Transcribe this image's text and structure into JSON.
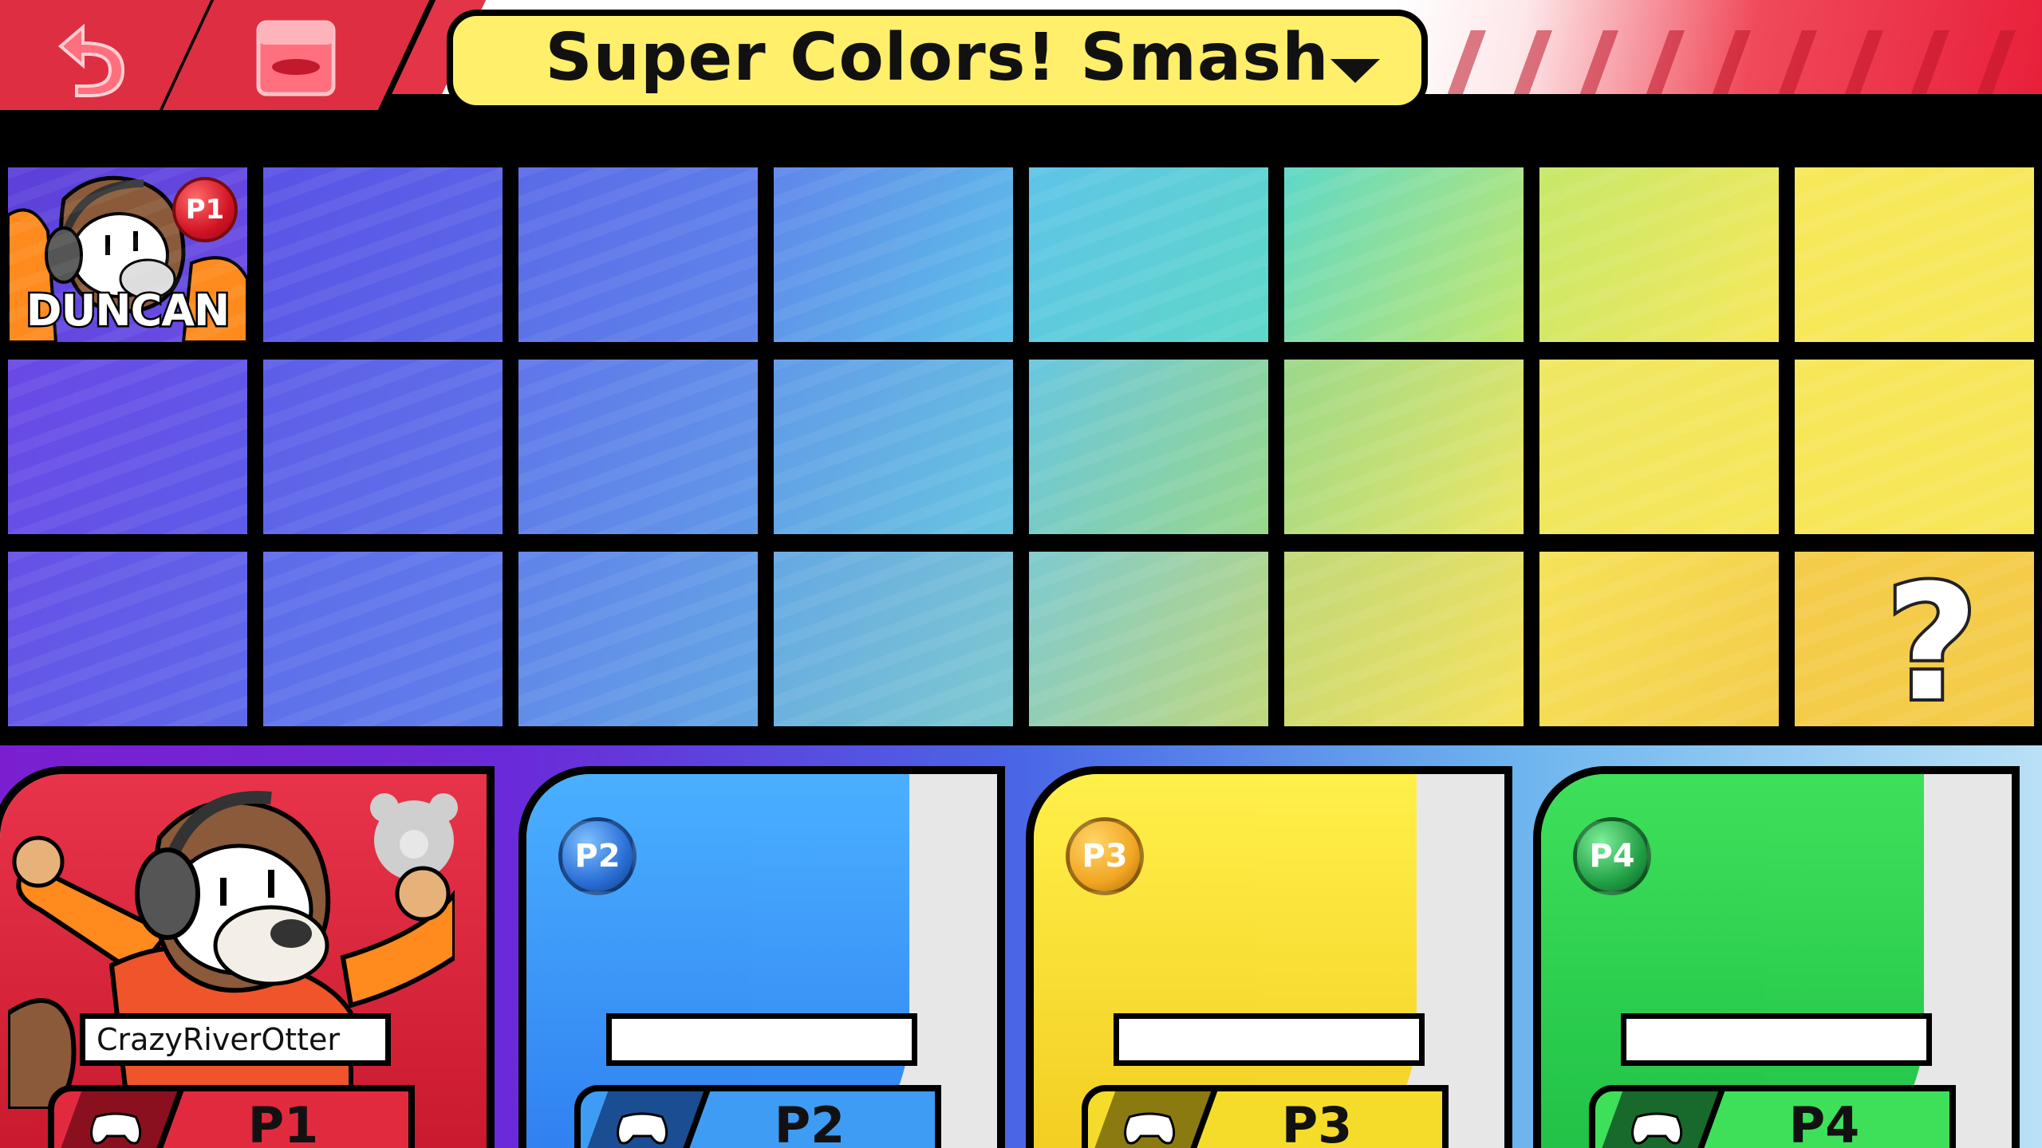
{
  "header": {
    "title": "Super Colors! Smash",
    "back_icon": "undo-arrow-icon",
    "rules_icon": "ruleset-icon",
    "dropdown_icon": "caret-down-icon"
  },
  "roster": {
    "fighters": [
      {
        "name": "DUNCAN",
        "token": "P1",
        "color": "#5b3fd8"
      }
    ],
    "random_label": "?",
    "row_colors": [
      [
        "#6a3ee0",
        "#5a52e6",
        "#5a6ae8",
        "#5f86ea",
        "#5ec4e8",
        "#5ed8c8",
        "#c6e86a",
        "#f7e85a"
      ],
      [
        "#6a48e6",
        "#5d5de8",
        "#5f75ea",
        "#609ae8",
        "#68c6e0",
        "#9ad88a",
        "#eee762",
        "#f7e658"
      ],
      [
        "#6650e6",
        "#5e6aea",
        "#5f82ea",
        "#64a8e4",
        "#7ecad0",
        "#c0d87a",
        "#f6e25a",
        "#f4cc4a"
      ]
    ]
  },
  "players": [
    {
      "slot": "P1",
      "name": "CrazyRiverOtter",
      "color": "#e22a3f",
      "token_color": "#d11424"
    },
    {
      "slot": "P2",
      "name": "",
      "color": "#3f9cf5",
      "token_color": "#2a6fd6"
    },
    {
      "slot": "P3",
      "name": "",
      "color": "#f5dc2a",
      "token_color": "#f2a622"
    },
    {
      "slot": "P4",
      "name": "",
      "color": "#3ee05a",
      "token_color": "#23a046"
    }
  ]
}
